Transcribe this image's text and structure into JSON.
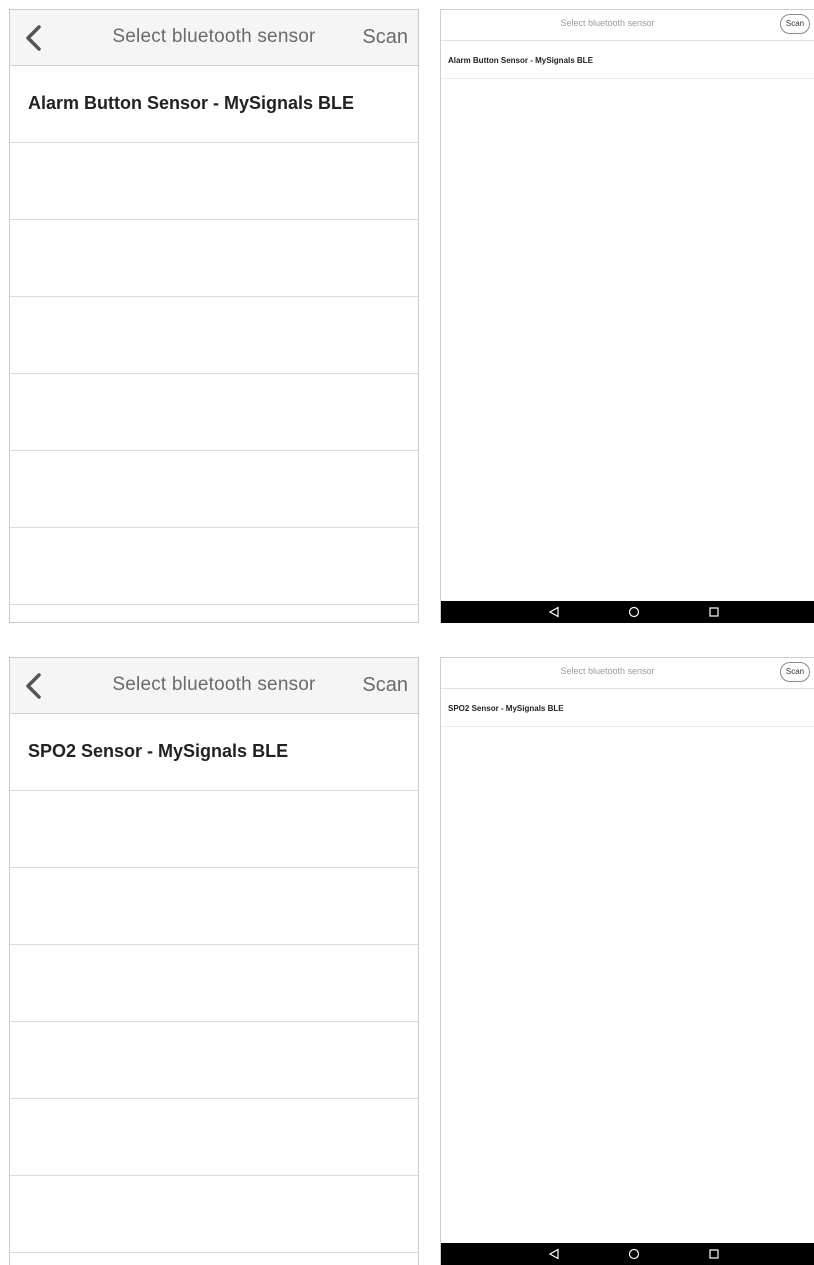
{
  "screens": [
    {
      "ios": {
        "title": "Select bluetooth sensor",
        "scan": "Scan",
        "items": [
          "Alarm Button Sensor - MySignals BLE"
        ]
      },
      "android": {
        "title": "Select bluetooth sensor",
        "scan": "Scan",
        "items": [
          "Alarm Button Sensor - MySignals BLE"
        ]
      }
    },
    {
      "ios": {
        "title": "Select bluetooth sensor",
        "scan": "Scan",
        "items": [
          "SPO2 Sensor - MySignals BLE"
        ]
      },
      "android": {
        "title": "Select bluetooth sensor",
        "scan": "Scan",
        "items": [
          "SPO2 Sensor - MySignals BLE"
        ]
      }
    }
  ],
  "icons": {
    "back": "chevron-left-icon",
    "android_back": "triangle-back-icon",
    "android_home": "circle-home-icon",
    "android_recents": "square-recents-icon"
  }
}
